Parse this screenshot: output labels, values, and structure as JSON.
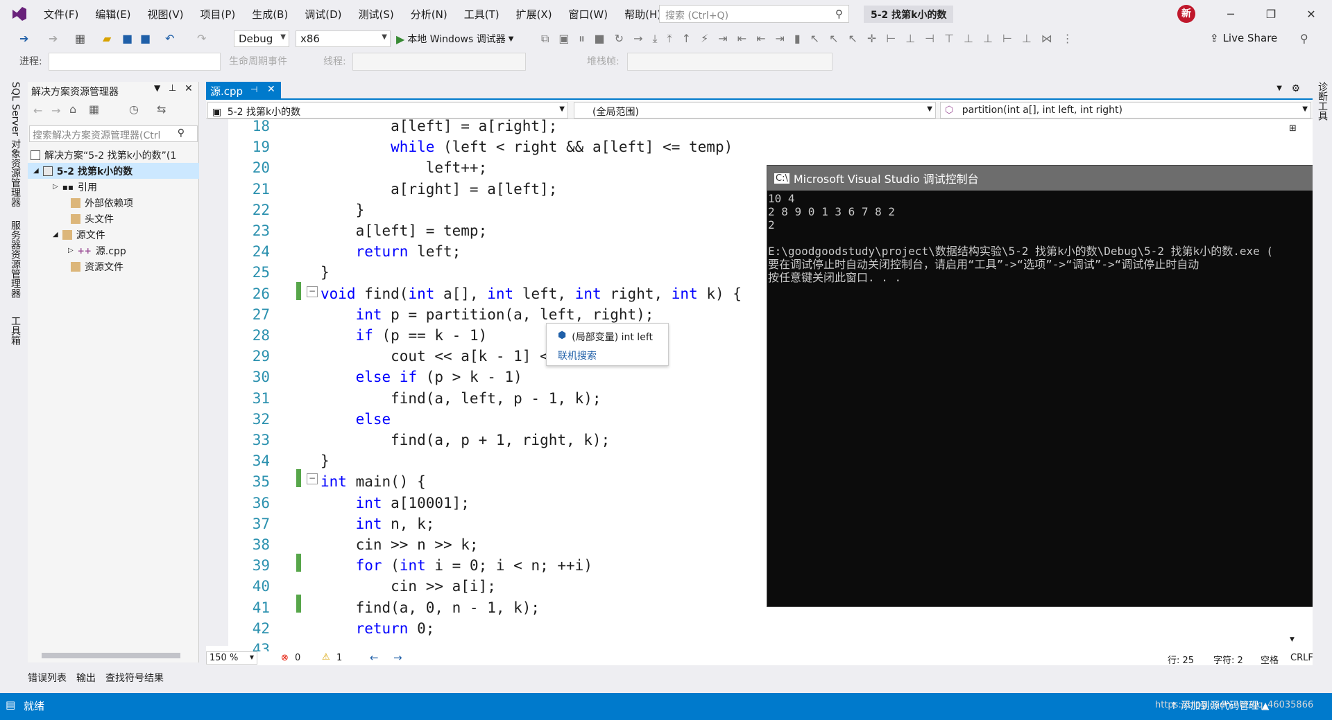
{
  "menu": [
    "文件(F)",
    "编辑(E)",
    "视图(V)",
    "项目(P)",
    "生成(B)",
    "调试(D)",
    "测试(S)",
    "分析(N)",
    "工具(T)",
    "扩展(X)",
    "窗口(W)",
    "帮助(H)"
  ],
  "search_placeholder": "搜索 (Ctrl+Q)",
  "solution_title": "5-2 找第k小的数",
  "user_badge": "新",
  "window_controls": {
    "minimize": "─",
    "restore": "❐",
    "close": "✕"
  },
  "toolbar": {
    "config": "Debug",
    "platform": "x86",
    "debugger": "本地 Windows 调试器",
    "live_share": "Live Share",
    "process_label": "进程:",
    "lifecycle_label": "生命周期事件",
    "thread_label": "线程:",
    "stackframe_label": "堆栈帧:"
  },
  "left_strip_tabs": [
    "SQL Server 对象资源管理器",
    "服务器资源管理器",
    "工具箱"
  ],
  "right_strip_tab": "诊断工具",
  "solution_explorer": {
    "title": "解决方案资源管理器",
    "search_placeholder": "搜索解决方案资源管理器(Ctrl",
    "items": [
      {
        "label": "解决方案“5-2 找第k小的数”(1"
      },
      {
        "label": "5-2 找第k小的数"
      },
      {
        "label": "引用"
      },
      {
        "label": "外部依赖项"
      },
      {
        "label": "头文件"
      },
      {
        "label": "源文件"
      },
      {
        "label": "源.cpp"
      },
      {
        "label": "资源文件"
      }
    ]
  },
  "bottom_tabs": [
    "错误列表",
    "输出",
    "查找符号结果"
  ],
  "editor": {
    "tab_name": "源.cpp",
    "tab_pin": "⊣",
    "tab_close": "✕",
    "nav_project": "5-2 找第k小的数",
    "nav_scope": "(全局范围)",
    "nav_member": "partition(int a[], int left, int right)",
    "lines": [
      {
        "n": "18",
        "text": "        a[left] = a[right];"
      },
      {
        "n": "19",
        "text": "        while (left < right && a[left] <= temp)"
      },
      {
        "n": "20",
        "text": "            left++;"
      },
      {
        "n": "21",
        "text": "        a[right] = a[left];"
      },
      {
        "n": "22",
        "text": "    }"
      },
      {
        "n": "23",
        "text": "    a[left] = temp;"
      },
      {
        "n": "24",
        "text": "    return left;"
      },
      {
        "n": "25",
        "text": "}"
      },
      {
        "n": "26",
        "text": "void find(int a[], int left, int right, int k) {"
      },
      {
        "n": "27",
        "text": "    int p = partition(a, left, right);"
      },
      {
        "n": "28",
        "text": "    if (p == k - 1)"
      },
      {
        "n": "29",
        "text": "        cout << a[k - 1] <<"
      },
      {
        "n": "30",
        "text": "    else if (p > k - 1)"
      },
      {
        "n": "31",
        "text": "        find(a, left, p - 1, k);"
      },
      {
        "n": "32",
        "text": "    else"
      },
      {
        "n": "33",
        "text": "        find(a, p + 1, right, k);"
      },
      {
        "n": "34",
        "text": "}"
      },
      {
        "n": "35",
        "text": "int main() {"
      },
      {
        "n": "36",
        "text": "    int a[10001];"
      },
      {
        "n": "37",
        "text": "    int n, k;"
      },
      {
        "n": "38",
        "text": "    cin >> n >> k;"
      },
      {
        "n": "39",
        "text": "    for (int i = 0; i < n; ++i)"
      },
      {
        "n": "40",
        "text": "        cin >> a[i];"
      },
      {
        "n": "41",
        "text": "    find(a, 0, n - 1, k);"
      },
      {
        "n": "42",
        "text": "    return 0;"
      },
      {
        "n": "43",
        "text": ""
      }
    ],
    "tooltip_type": "(局部变量) int left",
    "tooltip_link": "联机搜索",
    "zoom": "150 %",
    "errors": "0",
    "warnings": "1",
    "row": "行: 25",
    "col": "字符: 2",
    "indent": "空格",
    "eol": "CRLF"
  },
  "console": {
    "title": "Microsoft Visual Studio 调试控制台",
    "output": "10 4\n2 8 9 0 1 3 6 7 8 2\n2\n\nE:\\goodgoodstudy\\project\\数据结构实验\\5-2 找第k小的数\\Debug\\5-2 找第k小的数.exe (\n要在调试停止时自动关闭控制台，请启用“工具”->“选项”->“调试”->“调试停止时自动\n按任意键关闭此窗口. . ."
  },
  "statusbar": {
    "ready": "就绪",
    "right": "↑ 添加到源代码管理 ▲",
    "watermark": "https://blog.csdn.net/qq_46035866"
  },
  "colors": {
    "accent": "#007acc",
    "keyword": "#0000ff",
    "linenum": "#2b91af",
    "changebar": "#57a64a"
  }
}
